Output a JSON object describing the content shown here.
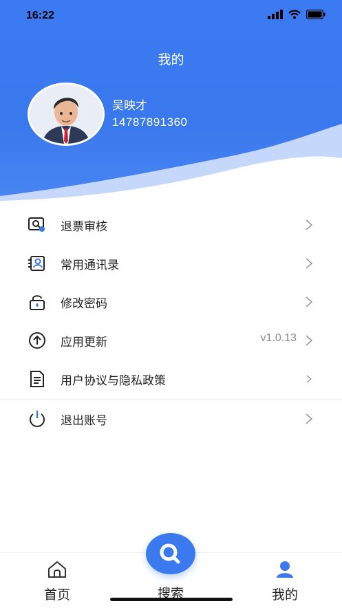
{
  "status_bar": {
    "time": "16:22"
  },
  "page": {
    "title": "我的"
  },
  "user": {
    "name": "吴映才",
    "phone": "14787891360"
  },
  "menu": [
    {
      "label": "退票审核",
      "icon": "ticket-search-icon"
    },
    {
      "label": "常用通讯录",
      "icon": "contacts-icon"
    },
    {
      "label": "修改密码",
      "icon": "lock-icon"
    },
    {
      "label": "应用更新",
      "icon": "upload-icon",
      "value": "v1.0.13"
    },
    {
      "label": "用户协议与隐私政策",
      "icon": "document-icon"
    },
    {
      "label": "退出账号",
      "icon": "power-icon"
    }
  ],
  "tabbar": {
    "home": "首页",
    "search": "搜索",
    "mine": "我的"
  },
  "colors": {
    "primary": "#3a79ee",
    "wave": "#c5d8fb"
  }
}
